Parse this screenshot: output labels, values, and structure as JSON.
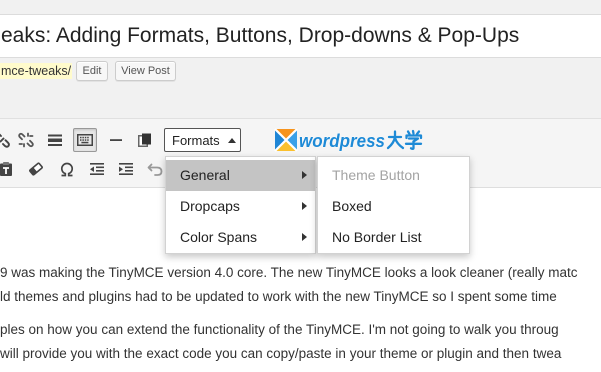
{
  "title": {
    "value": "eaks: Adding Formats, Buttons, Drop-downs & Pop-Ups"
  },
  "permalink": {
    "slug": "mce-tweaks/",
    "edit_label": "Edit",
    "view_label": "View Post"
  },
  "toolbar": {
    "row1": [
      {
        "icon": "link-icon"
      },
      {
        "icon": "unlink-icon"
      },
      {
        "icon": "read-more-icon"
      },
      {
        "icon": "toolbar-toggle-icon",
        "pressed": true
      },
      {
        "icon": "horizontal-line-icon"
      },
      {
        "icon": "copy-icon"
      }
    ],
    "formats_button": {
      "label": "Formats",
      "icon": "caret-up-icon",
      "open": true
    },
    "row2": [
      {
        "icon": "paste-as-text-icon"
      },
      {
        "icon": "eraser-icon"
      },
      {
        "icon": "special-character-icon"
      },
      {
        "icon": "outdent-icon"
      },
      {
        "icon": "indent-icon"
      },
      {
        "icon": "undo-icon"
      }
    ]
  },
  "formats_menu": {
    "items": [
      {
        "label": "General",
        "active": true,
        "icon": "caret-right-icon"
      },
      {
        "label": "Dropcaps",
        "icon": "caret-right-icon"
      },
      {
        "label": "Color Spans",
        "icon": "caret-right-icon"
      }
    ],
    "submenu": {
      "items": [
        {
          "label": "Theme Button",
          "muted": true
        },
        {
          "label": "Boxed"
        },
        {
          "label": "No Border List"
        }
      ]
    }
  },
  "watermark": {
    "text": "wordpress大学",
    "icon": "x-logo-icon"
  },
  "content": {
    "paragraphs": [
      {
        "lines": [
          "9 was making the TinyMCE version 4.0 core. The new TinyMCE looks a look cleaner (really matc",
          "ld themes and plugins had to be updated to work with the new TinyMCE so I spent some time"
        ]
      },
      {
        "lines": [
          "ples on how you can extend the functionality of the TinyMCE. I'm not going to walk you throug",
          "will provide you with the exact code you can copy/paste in your theme or plugin and then twea"
        ]
      }
    ]
  },
  "colors": {
    "menu_highlight": "#c4c4c4",
    "permalink_highlight": "#fffbcc",
    "watermark_blue": "#1e8ad6",
    "watermark_orange": "#f7941d",
    "body_text": "#333333"
  }
}
